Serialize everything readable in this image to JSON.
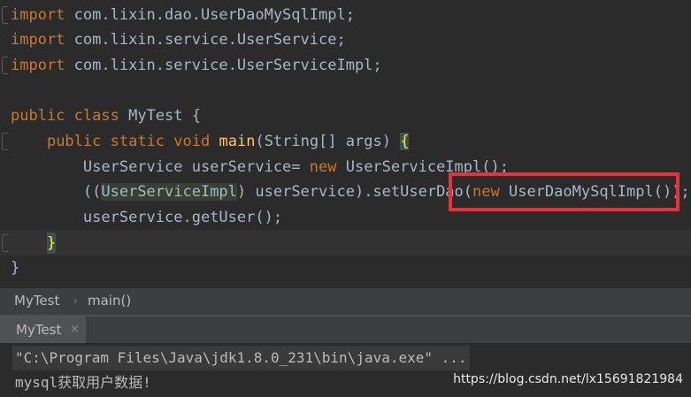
{
  "editor": {
    "imports": [
      {
        "keyword": "import",
        "path": " com.lixin.dao.UserDaoMySqlImpl;"
      },
      {
        "keyword": "import",
        "path": " com.lixin.service.UserService;"
      },
      {
        "keyword": "import",
        "path": " com.lixin.service.UserServiceImpl;"
      }
    ],
    "class_line": {
      "kw1": "public",
      "kw2": "class",
      "name": " MyTest {"
    },
    "main_line": {
      "indent": "    ",
      "kw1": "public",
      "kw2": "static",
      "kw3": "void",
      "fn": "main",
      "params": "(String[] args) ",
      "brace": "{"
    },
    "line_service": {
      "indent": "        ",
      "decl": "UserService userService= ",
      "kw": "new",
      "rest": " UserServiceImpl();"
    },
    "line_cast": {
      "indent": "        ",
      "open": "((",
      "cast": "UserServiceImpl",
      "mid": ") userService).setUserDao(",
      "kw": "new",
      "rest": " UserDaoMySqlImpl());"
    },
    "line_get": {
      "indent": "        ",
      "text": "userService.getUser();"
    },
    "line_close_method": {
      "indent": "    ",
      "brace": "}"
    },
    "line_close_class": "}"
  },
  "breadcrumb": {
    "file": "MyTest",
    "separator": "›",
    "method": "main()"
  },
  "run": {
    "tab_label": "MyTest",
    "tab_close": "×",
    "console_lines": [
      "\"C:\\Program Files\\Java\\jdk1.8.0_231\\bin\\java.exe\" ...",
      "mysql获取用户数据!"
    ]
  },
  "watermark": "https://blog.csdn.net/lx15691821984",
  "colors": {
    "keyword": "#cc7832",
    "method": "#ffc66d",
    "text": "#a9b7c6",
    "highlight_box": "#e8323a",
    "background": "#2b2b2b"
  }
}
